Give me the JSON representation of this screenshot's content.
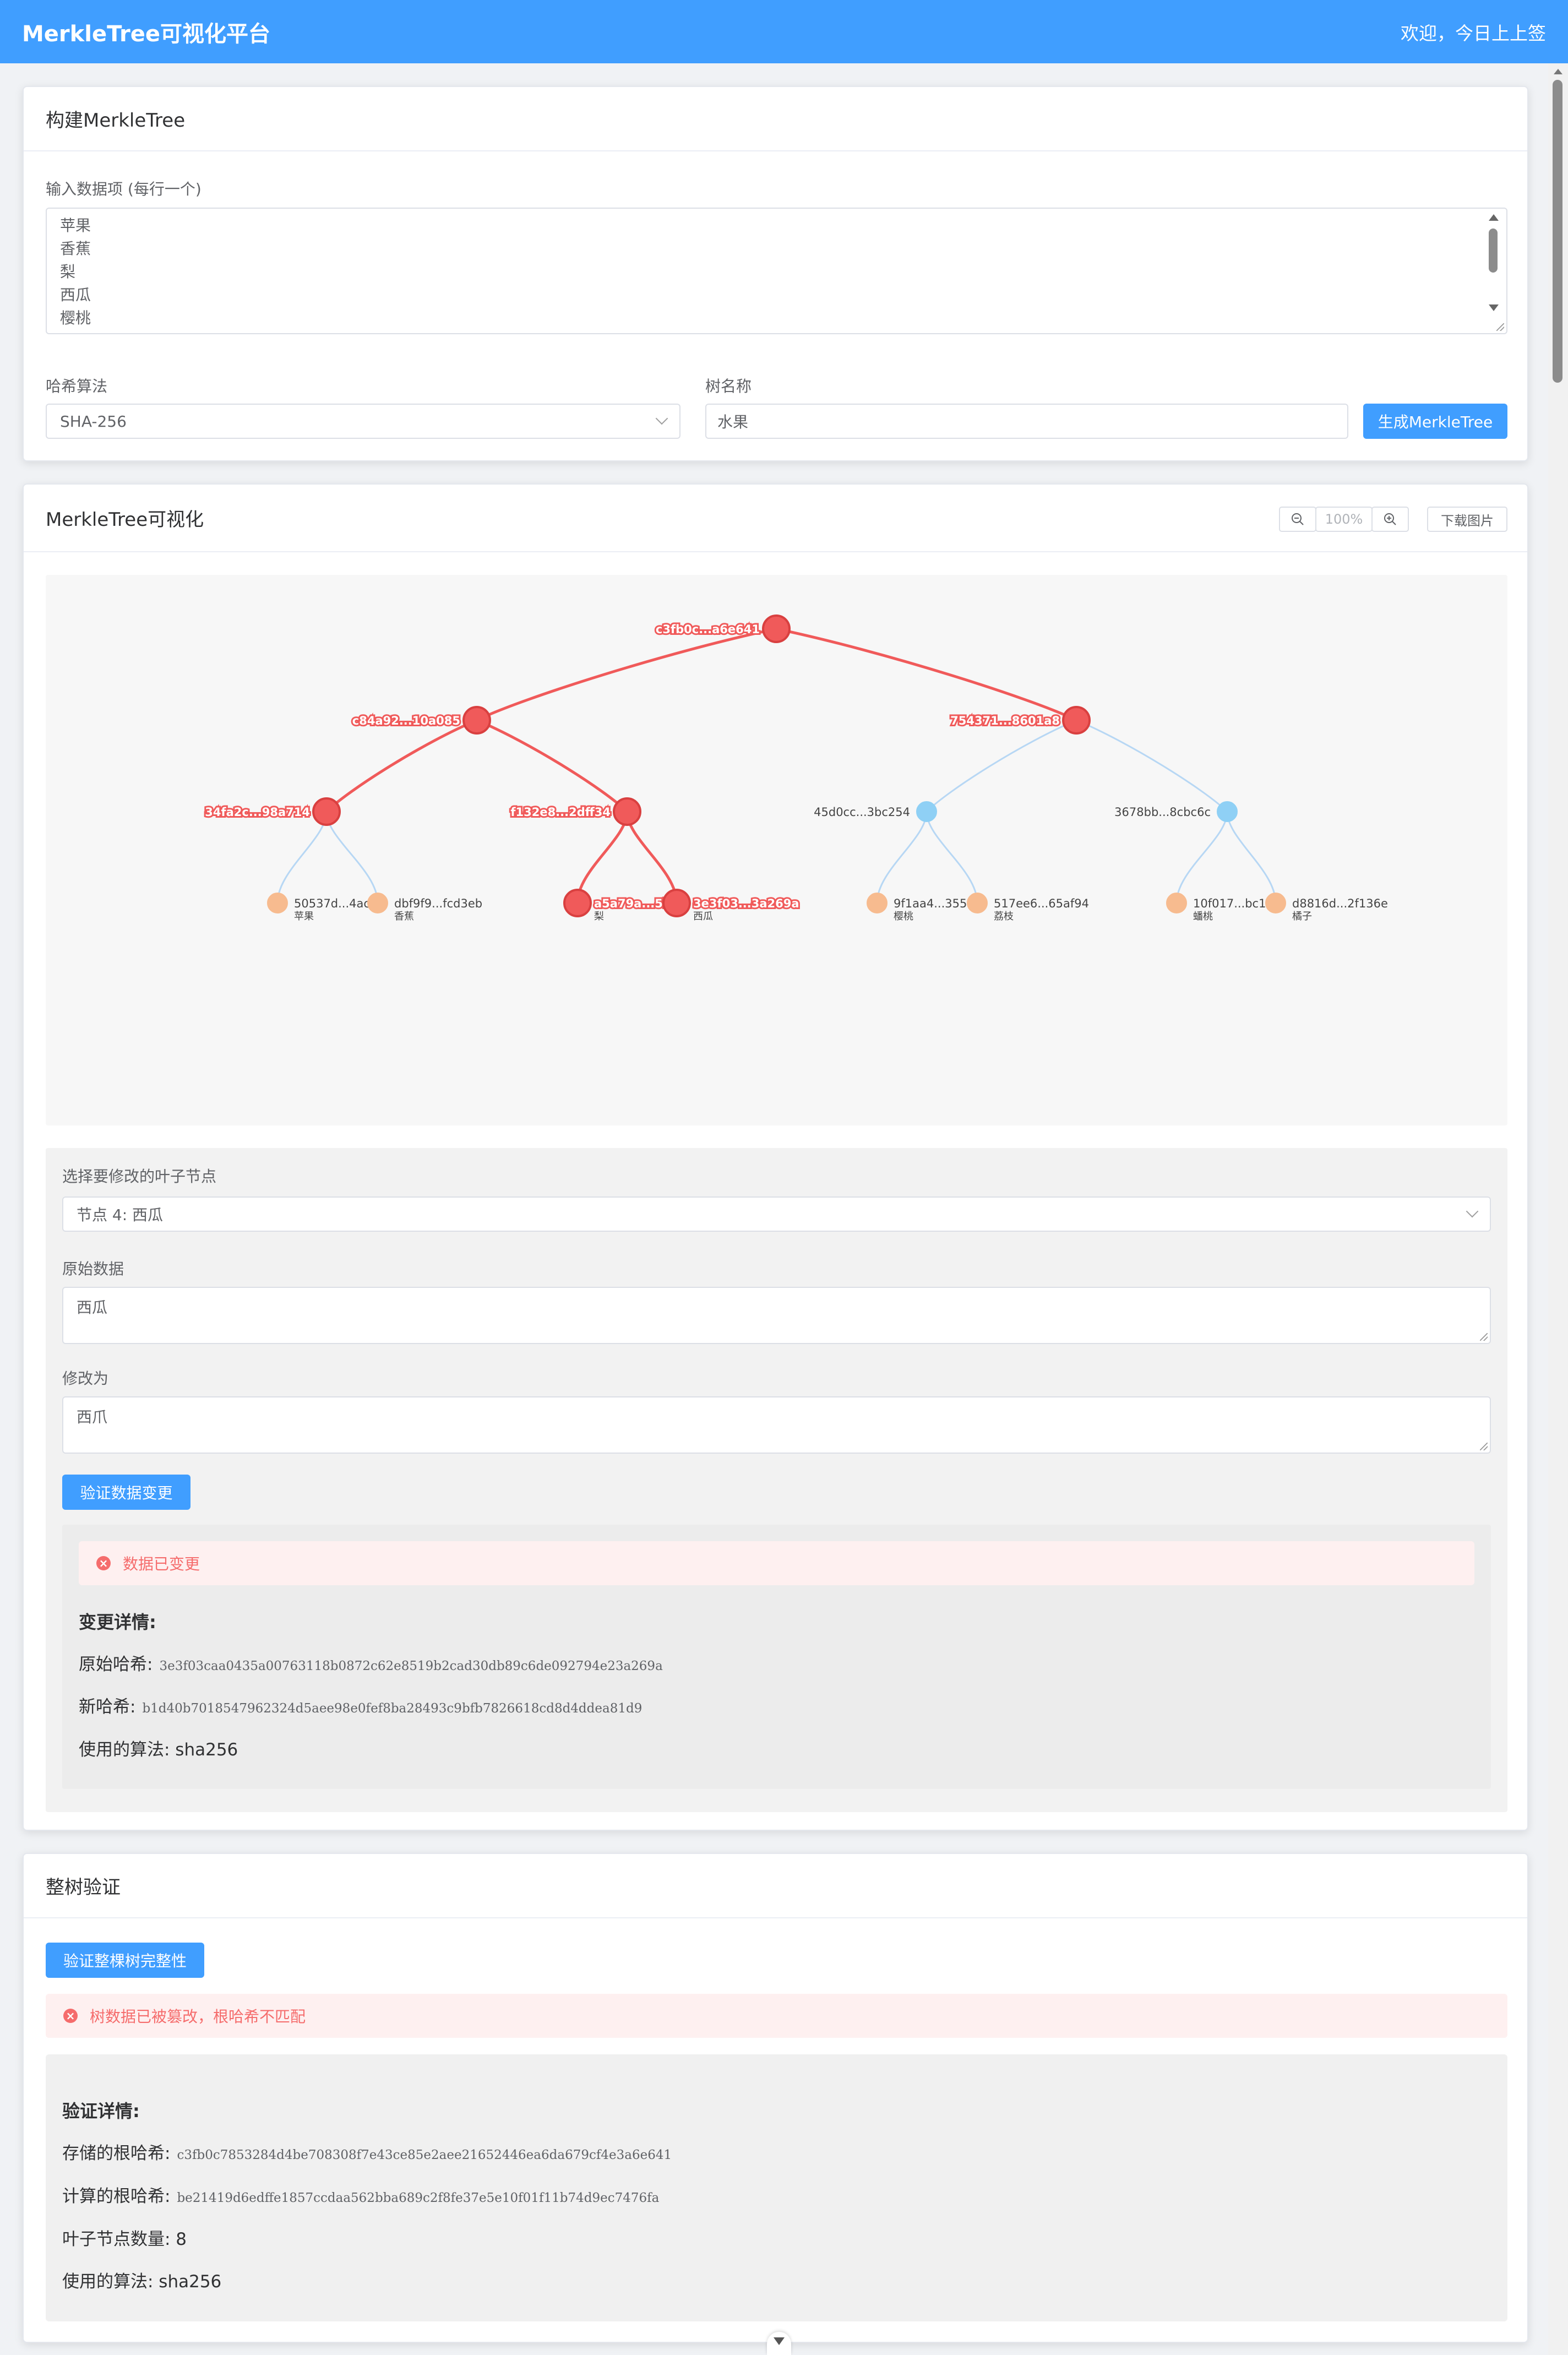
{
  "header": {
    "title": "MerkleTree可视化平台",
    "welcome": "欢迎，今日上上签"
  },
  "build": {
    "title": "构建MerkleTree",
    "input_label": "输入数据项 (每行一个)",
    "input_lines": [
      "苹果",
      "香蕉",
      "梨",
      "西瓜",
      "樱桃"
    ],
    "hash_label": "哈希算法",
    "hash_value": "SHA-256",
    "name_label": "树名称",
    "name_value": "水果",
    "generate_button": "生成MerkleTree"
  },
  "viz": {
    "title": "MerkleTree可视化",
    "zoom": "100%",
    "download_button": "下载图片",
    "colors": {
      "highlight": "#f05a5a",
      "normal_internal": "#8fd0f5",
      "leaf": "#f7bb8f",
      "edge_normal": "#b7d7f4"
    },
    "tree": {
      "root": "c3fb0c...a6e641",
      "level1": [
        "c84a92...10a085",
        "754371...8601a8"
      ],
      "level2": [
        "34fa2c...98a714",
        "f132e8...2dff34",
        "45d0cc...3bc254",
        "3678bb...8cbc6c"
      ],
      "leaves": [
        {
          "hash": "50537d...4ac",
          "data": "苹果"
        },
        {
          "hash": "dbf9f9...fcd3eb",
          "data": "香蕉"
        },
        {
          "hash": "a5a79a...5b",
          "data": "梨"
        },
        {
          "hash": "3e3f03...3a269a",
          "data": "西瓜"
        },
        {
          "hash": "9f1aa4...355(",
          "data": "樱桃"
        },
        {
          "hash": "517ee6...65af94",
          "data": "荔枝"
        },
        {
          "hash": "10f017...bc1c",
          "data": "蟠桃"
        },
        {
          "hash": "d8816d...2f136e",
          "data": "橘子"
        }
      ]
    }
  },
  "modify": {
    "select_label": "选择要修改的叶子节点",
    "select_value": "节点 4: 西瓜",
    "original_label": "原始数据",
    "original_value": "西瓜",
    "modified_label": "修改为",
    "modified_value": "西爪",
    "verify_button": "验证数据变更",
    "alert": "数据已变更",
    "details_title": "变更详情:",
    "orig_hash_label": "原始哈希:",
    "orig_hash": "3e3f03caa0435a00763118b0872c62e8519b2cad30db89c6de092794e23a269a",
    "new_hash_label": "新哈希:",
    "new_hash": "b1d40b7018547962324d5aee98e0fef8ba28493c9bfb7826618cd8d4ddea81d9",
    "algo_text": "使用的算法: sha256"
  },
  "whole": {
    "title": "整树验证",
    "verify_button": "验证整棵树完整性",
    "alert": "树数据已被篡改，根哈希不匹配",
    "details_title": "验证详情:",
    "stored_label": "存储的根哈希:",
    "stored_hash": "c3fb0c7853284d4be708308f7e43ce85e2aee21652446ea6da679cf4e3a6e641",
    "computed_label": "计算的根哈希:",
    "computed_hash": "be21419d6edffe1857ccdaa562bba689c2f8fe37e5e10f01f11b74d9ec7476fa",
    "leaf_count": "叶子节点数量: 8",
    "algo_text": "使用的算法: sha256"
  }
}
